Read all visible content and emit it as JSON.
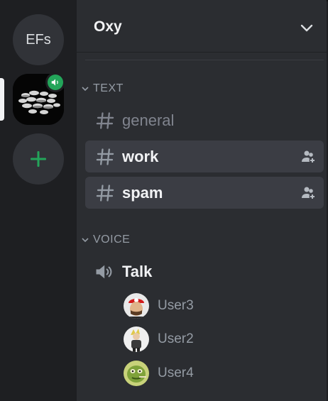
{
  "servers": [
    {
      "label": "EFs"
    },
    {
      "label": "",
      "has_voice": true
    },
    {
      "label": "+"
    }
  ],
  "server": {
    "name": "Oxy"
  },
  "categories": {
    "text": "TEXT",
    "voice": "VOICE"
  },
  "text_channels": [
    {
      "name": "general",
      "state": "unread-off"
    },
    {
      "name": "work",
      "state": "hover"
    },
    {
      "name": "spam",
      "state": "selected"
    }
  ],
  "voice_channel": {
    "name": "Talk"
  },
  "voice_users": [
    "User3",
    "User2",
    "User4"
  ],
  "colors": {
    "rail": "#1e1f22",
    "panel": "#2b2d31",
    "active": "#3b3d44",
    "green": "#23a55a"
  },
  "icons": {
    "channel": "hash-icon",
    "voice": "speaker-icon",
    "invite": "add-member-icon",
    "chevron": "chevron-down-icon"
  }
}
